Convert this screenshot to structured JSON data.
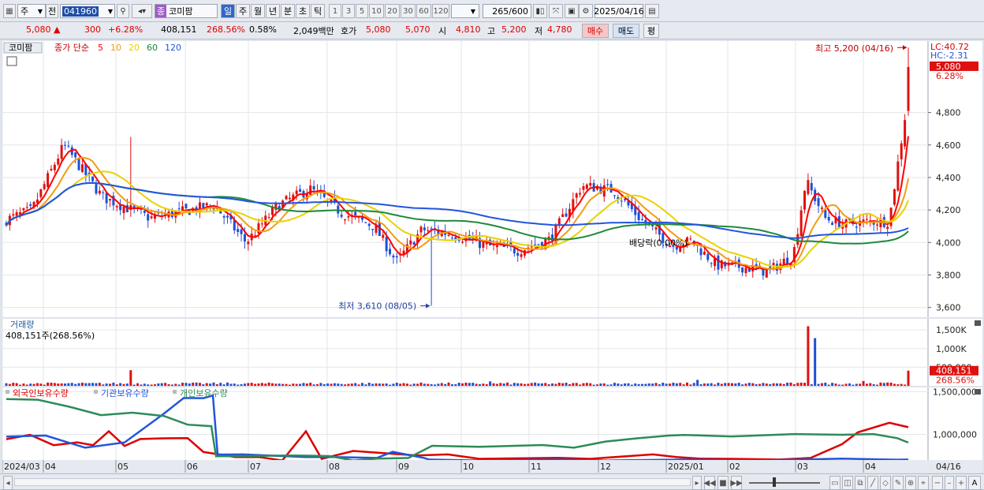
{
  "toolbar": {
    "market": "주",
    "prev_label": "전",
    "stock_code": "041960",
    "stock_name": "코미팜",
    "stock_tag": "종",
    "periods": [
      "일",
      "주",
      "월",
      "년",
      "분",
      "초",
      "틱"
    ],
    "active_period": "일",
    "intervals": [
      "1",
      "3",
      "5",
      "10",
      "20",
      "30",
      "60",
      "120"
    ],
    "count": "265",
    "count_total": "/600",
    "date": "2025/04/16"
  },
  "quote": {
    "price": "5,080",
    "arrow": "▲",
    "change": "300",
    "change_pct": "+6.28%",
    "volume": "408,151",
    "volume_ratio": "268.56%",
    "turnover": "0.58%",
    "amount": "2,049백만",
    "ask_label": "호가",
    "ask": "5,080",
    "bid": "5,070",
    "open_label": "시",
    "open": "4,810",
    "high_label": "고",
    "high": "5,200",
    "low_label": "저",
    "low": "4,780",
    "buy_label": "매수",
    "sell_label": "매도",
    "avg_label": "평"
  },
  "price_panel": {
    "name": "코미팜",
    "ma_label": "종가 단순",
    "ma_periods": [
      "5",
      "10",
      "20",
      "60",
      "120"
    ],
    "ma_colors": [
      "#ff0000",
      "#f39c12",
      "#e8d200",
      "#1f8a3a",
      "#2255dd"
    ],
    "lc": "LC:40.72",
    "hc": "HC:-2.31",
    "last_price": "5,080",
    "last_pct": "6.28%",
    "high_annotation": "최고 5,200 (04/16)",
    "low_annotation": "최저 3,610 (08/05)",
    "dividend_annotation": "배당락(0.00%)",
    "y_ticks": [
      "4,800",
      "4,600",
      "4,400",
      "4,200",
      "4,000",
      "3,800",
      "3,600"
    ]
  },
  "volume_panel": {
    "title": "거래량",
    "summary": "408,151주(268.56%)",
    "y_ticks": [
      "1,500K",
      "1,000K",
      "500,000"
    ],
    "last_value": "408,151",
    "last_pct": "268.56%"
  },
  "holding_panel": {
    "series_labels": [
      "외국인보유수량",
      "기관보유수량",
      "개인보유수량"
    ],
    "series_colors": [
      "#dd0000",
      "#2255dd",
      "#2e8b57"
    ],
    "y_ticks": [
      "1,500,000",
      "1,000,000"
    ]
  },
  "x_axis": {
    "labels": [
      "2024/03",
      "04",
      "05",
      "06",
      "07",
      "08",
      "09",
      "10",
      "11",
      "12",
      "2025/01",
      "02",
      "03",
      "04"
    ],
    "current_label": "04/16"
  },
  "chart_data": [
    {
      "type": "candlestick",
      "title": "코미팜",
      "x": [
        "2024/03",
        "04",
        "05",
        "06",
        "07",
        "08",
        "09",
        "10",
        "11",
        "12",
        "2025/01",
        "02",
        "03",
        "04/16"
      ],
      "ylim": [
        3540,
        5240
      ],
      "close_approx": [
        4150,
        4250,
        4200,
        4120,
        4230,
        4090,
        3950,
        4100,
        4300,
        3900,
        3860,
        4150,
        4110,
        5080
      ],
      "high": {
        "value": 5200,
        "date": "04/16"
      },
      "low": {
        "value": 3610,
        "date": "08/05"
      },
      "moving_averages": [
        "5",
        "10",
        "20",
        "60",
        "120"
      ]
    },
    {
      "type": "bar",
      "title": "거래량",
      "last_value": 408151,
      "last_ratio_pct": 268.56,
      "ylim": [
        0,
        1800000
      ]
    },
    {
      "type": "line",
      "series": [
        {
          "name": "외국인보유수량"
        },
        {
          "name": "기관보유수량"
        },
        {
          "name": "개인보유수량"
        }
      ],
      "ylim": [
        700000,
        1550000
      ]
    }
  ]
}
